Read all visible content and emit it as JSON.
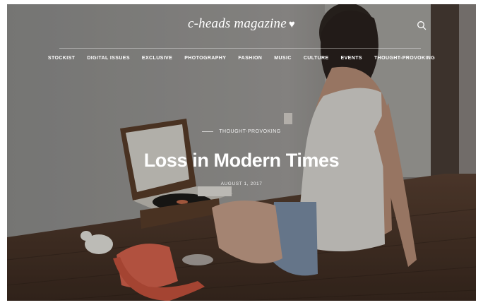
{
  "site": {
    "name": "c-heads magazine",
    "heart": "♥"
  },
  "nav": {
    "items": [
      "STOCKIST",
      "DIGITAL ISSUES",
      "EXCLUSIVE",
      "PHOTOGRAPHY",
      "FASHION",
      "MUSIC",
      "CULTURE",
      "EVENTS",
      "THOUGHT-PROVOKING"
    ]
  },
  "hero": {
    "category": "THOUGHT-PROVOKING",
    "title": "Loss in Modern Times",
    "date": "AUGUST 1, 2017"
  },
  "icons": {
    "search": "search-icon"
  },
  "colors": {
    "text": "#ffffff",
    "wall": "#8e8e8c",
    "floor": "#4a3528",
    "phone": "#d8634d"
  }
}
